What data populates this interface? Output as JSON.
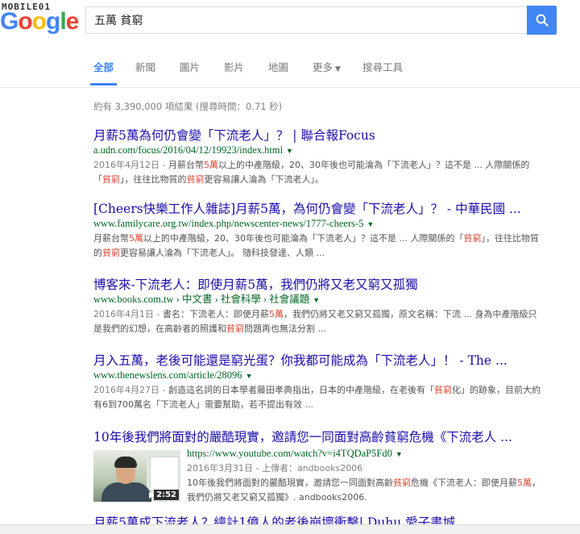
{
  "watermark": "MOBILE01",
  "logo": {
    "g1": "G",
    "o1": "o",
    "o2": "o",
    "g2": "g",
    "l": "l",
    "e": "e"
  },
  "search": {
    "query": "五萬 貧窮"
  },
  "tabs": [
    {
      "label": "全部",
      "active": true
    },
    {
      "label": "新聞"
    },
    {
      "label": "圖片"
    },
    {
      "label": "影片"
    },
    {
      "label": "地圖"
    },
    {
      "label": "更多"
    },
    {
      "label": "搜尋工具"
    }
  ],
  "stats": "約有 3,390,000 項結果 (搜尋時間：0.71 秒)",
  "results": [
    {
      "title": "月薪5萬為何仍會變「下流老人」？ | 聯合報Focus",
      "url": "a.udn.com/focus/2016/04/12/19923/index.html",
      "date": "2016年4月12日 - ",
      "snippet": [
        {
          "t": "月薪台幣"
        },
        {
          "t": "5萬",
          "hl": true
        },
        {
          "t": "以上的中產階級，20、30年後也可能淪為「下流老人」？這不是 ... 人際關係的「"
        },
        {
          "t": "貧窮",
          "hl": true
        },
        {
          "t": "」，往往比物質的"
        },
        {
          "t": "貧窮",
          "hl": true
        },
        {
          "t": "更容易讓人淪為「下流老人」。"
        }
      ]
    },
    {
      "title": "[Cheers快樂工作人雜誌]月薪5萬，為何仍會變「下流老人」？ - 中華民國 ...",
      "url": "www.familycare.org.tw/index.php/newscenter-news/1777-cheers-5",
      "date": "",
      "snippet": [
        {
          "t": "月薪台幣"
        },
        {
          "t": "5萬",
          "hl": true
        },
        {
          "t": "以上的中產階級，20、30年後也可能淪為「下流老人」？這不是 ... 人際關係的「"
        },
        {
          "t": "貧窮",
          "hl": true
        },
        {
          "t": "」，往往比物質的"
        },
        {
          "t": "貧窮",
          "hl": true
        },
        {
          "t": "更容易讓人淪為「下流老人」。 隨科技發達、人類 ..."
        }
      ]
    },
    {
      "title": "博客來-下流老人：即使月薪5萬，我們仍將又老又窮又孤獨",
      "url": "www.books.com.tw › 中文書 › 社會科學 › 社會議題",
      "date": "2016年4月1日 - ",
      "snippet": [
        {
          "t": "書名：下流老人：即使月薪"
        },
        {
          "t": "5萬",
          "hl": true
        },
        {
          "t": "，我們仍將又老又窮又孤獨，原文名稱：下流 ... 身為中產階級只是我們的幻想，在高齡者的照護和"
        },
        {
          "t": "貧窮",
          "hl": true
        },
        {
          "t": "問題再也無法分割 ..."
        }
      ]
    },
    {
      "title": "月入五萬，老後可能還是窮光蛋？你我都可能成為「下流老人」！ - The ...",
      "url": "www.thenewslens.com/article/28096",
      "date": "2016年4月27日 - ",
      "snippet": [
        {
          "t": "創造這名詞的日本學者藤田孝典指出，日本的中產階級，在老後有「"
        },
        {
          "t": "貧窮",
          "hl": true
        },
        {
          "t": "化」的跡象，目前大約有6到700萬名「下流老人」需要幫助，若不提出有效 ..."
        }
      ]
    }
  ],
  "video": {
    "title": "10年後我們將面對的嚴酷現實，邀請您一同面對高齡貧窮危機《下流老人 ...",
    "url": "https://www.youtube.com/watch?v=i4TQDaP5Fd0",
    "date": "2016年3月31日 - 上傳者：andbooks2006",
    "snippet": [
      {
        "t": "10年後我們將面對的嚴酷現實，邀請您一同面對高齡"
      },
      {
        "t": "貧窮",
        "hl": true
      },
      {
        "t": "危機《下流老人：即使月薪"
      },
      {
        "t": "5萬",
        "hl": true
      },
      {
        "t": "，我們仍將又老又窮又孤獨》. andbooks2006."
      }
    ],
    "duration": "2:52"
  },
  "partial_title": "月薪5萬成下流老人？總計1億人的老後崩壞衝擊| Duhu 愛子書城"
}
